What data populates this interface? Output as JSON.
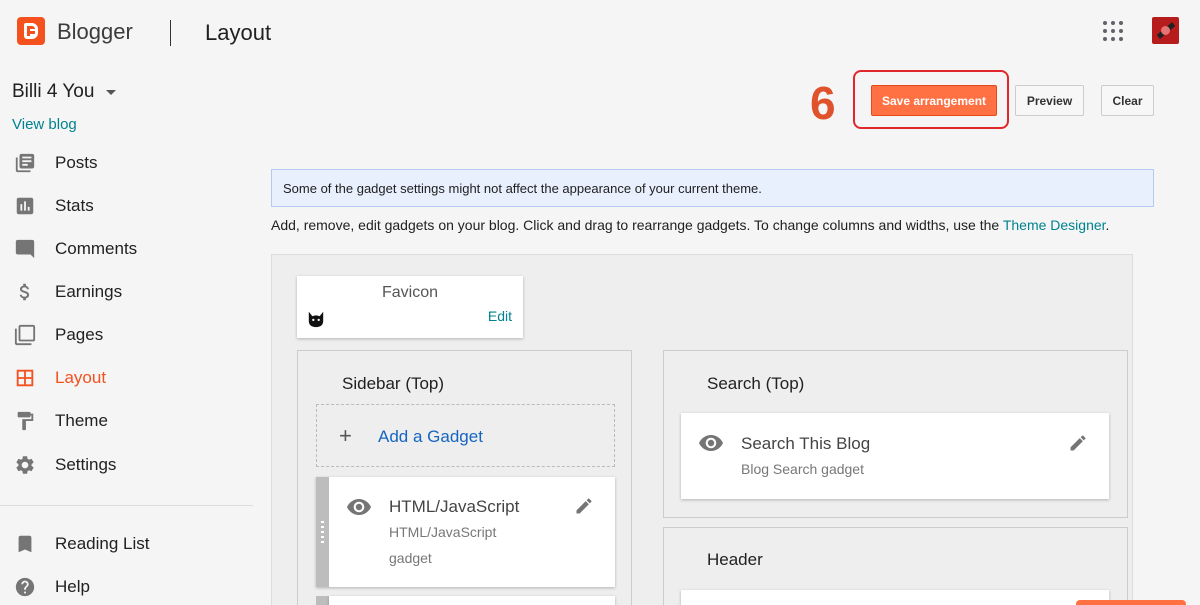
{
  "app": {
    "brand": "Blogger",
    "page_title": "Layout"
  },
  "sidebar": {
    "blog_name": "Billi 4 You",
    "view_blog": "View blog",
    "items": [
      {
        "label": "Posts",
        "icon": "posts-icon"
      },
      {
        "label": "Stats",
        "icon": "stats-icon"
      },
      {
        "label": "Comments",
        "icon": "comments-icon"
      },
      {
        "label": "Earnings",
        "icon": "dollar-icon"
      },
      {
        "label": "Pages",
        "icon": "pages-icon"
      },
      {
        "label": "Layout",
        "icon": "layout-icon",
        "active": true
      },
      {
        "label": "Theme",
        "icon": "paint-roller-icon"
      },
      {
        "label": "Settings",
        "icon": "gear-icon"
      },
      {
        "label": "Reading List",
        "icon": "bookmark-icon"
      },
      {
        "label": "Help",
        "icon": "help-icon"
      }
    ]
  },
  "toolbar": {
    "step_number": "6",
    "save_label": "Save arrangement",
    "preview_label": "Preview",
    "clear_label": "Clear"
  },
  "notice": "Some of the gadget settings might not affect the appearance of your current theme.",
  "help": {
    "text": "Add, remove, edit gadgets on your blog. Click and drag to rearrange gadgets. To change columns and widths, use the ",
    "link": "Theme Designer",
    "end": "."
  },
  "layout": {
    "favicon": {
      "title": "Favicon",
      "edit": "Edit"
    },
    "sidebar_top": {
      "title": "Sidebar (Top)",
      "add_gadget": "Add a Gadget",
      "gadget": {
        "title": "HTML/JavaScript",
        "subtitle_1": "HTML/JavaScript",
        "subtitle_2": "gadget"
      }
    },
    "search_top": {
      "title": "Search (Top)",
      "gadget": {
        "title": "Search This Blog",
        "subtitle": "Blog Search gadget"
      }
    },
    "header": {
      "title": "Header"
    }
  },
  "colors": {
    "accent": "#f4511e",
    "link": "#00838f",
    "highlight": "#e0272b",
    "save_button": "#ff7043"
  }
}
